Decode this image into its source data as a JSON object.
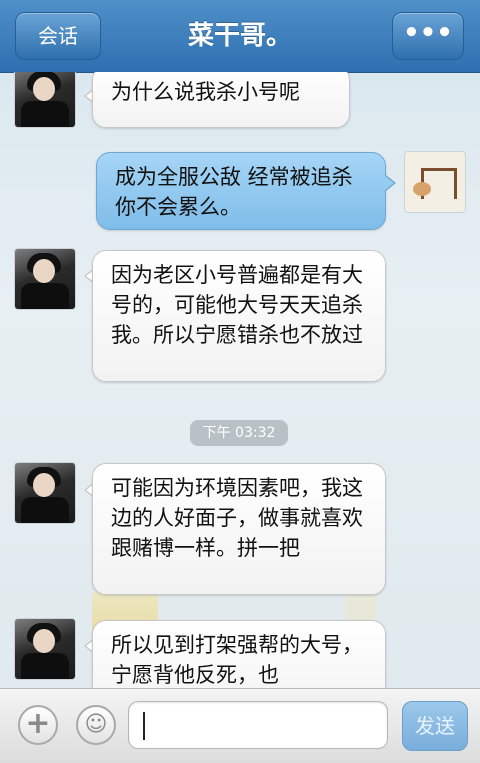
{
  "header": {
    "back_label": "会话",
    "title": "菜干哥。",
    "more_label": "•••",
    "more_icon": "more-dots-icon"
  },
  "messages": [
    {
      "side": "left",
      "text": "为什么说我杀小号呢"
    },
    {
      "side": "right",
      "text": "成为全服公敌 经常被追杀 你不会累么。"
    },
    {
      "side": "left",
      "text": "因为老区小号普遍都是有大号的，可能他大号天天追杀我。所以宁愿错杀也不放过"
    },
    {
      "side": "left",
      "text": "可能因为环境因素吧，我这边的人好面子，做事就喜欢跟赌博一样。拼一把"
    },
    {
      "side": "left",
      "text": "所以见到打架强帮的大号，宁愿背他反死，也"
    }
  ],
  "timestamp": "下午 03:32",
  "input": {
    "add_icon": "plus-icon",
    "emoji_icon": "smiley-icon",
    "placeholder": "",
    "send_label": "发送"
  },
  "colors": {
    "nav_bar": "#2e6fb0",
    "bubble_me": "#8fc7ee",
    "bubble_other": "#ffffff"
  }
}
